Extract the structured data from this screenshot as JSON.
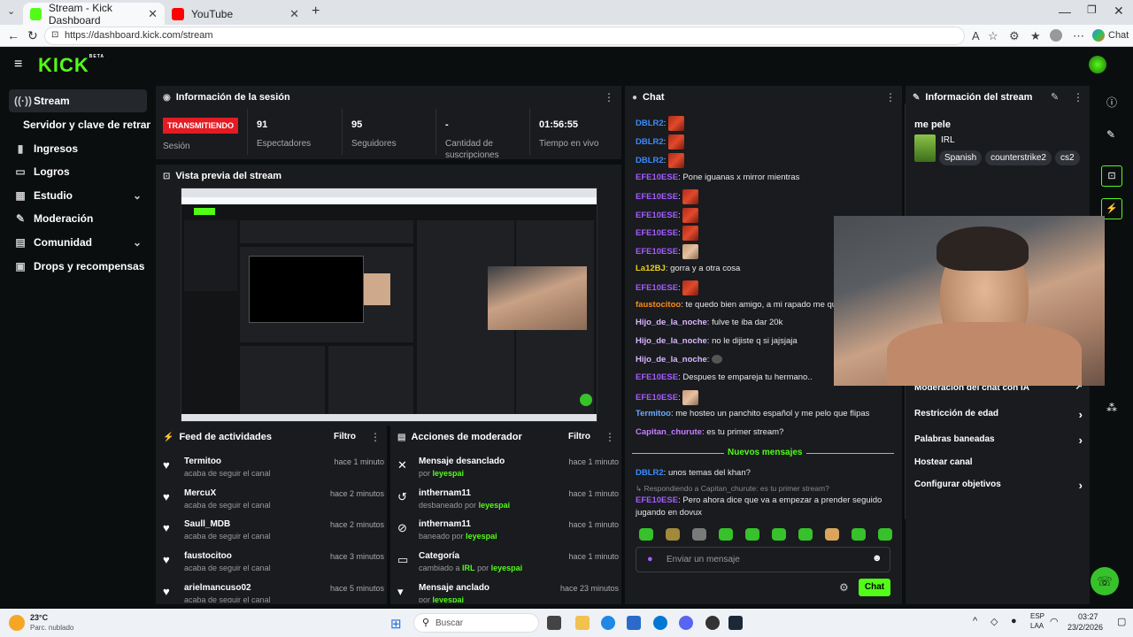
{
  "browser": {
    "tabs": [
      {
        "label": "Stream - Kick Dashboard"
      },
      {
        "label": "YouTube"
      }
    ],
    "url": "https://dashboard.kick.com/stream",
    "chat_button": "Chat"
  },
  "brand": {
    "logo": "KICK",
    "beta": "BETA",
    "accent": "#53fc18"
  },
  "sidebar": {
    "items": [
      {
        "label": "Stream",
        "icon": "stream-icon"
      },
      {
        "label": "Servidor y clave de retransm"
      },
      {
        "label": "Ingresos",
        "icon": "chart-icon"
      },
      {
        "label": "Logros",
        "icon": "trophy-icon"
      },
      {
        "label": "Estudio",
        "icon": "studio-icon"
      },
      {
        "label": "Moderación",
        "icon": "wrench-icon"
      },
      {
        "label": "Comunidad",
        "icon": "community-icon"
      },
      {
        "label": "Drops y recompensas",
        "icon": "gift-icon"
      }
    ]
  },
  "session": {
    "title": "Información de la sesión",
    "status": "TRANSMITIENDO",
    "status_label": "Sesión",
    "stats": [
      {
        "value": "91",
        "label": "Espectadores"
      },
      {
        "value": "95",
        "label": "Seguidores"
      },
      {
        "value": "-",
        "label": "Cantidad de suscripciones"
      },
      {
        "value": "01:56:55",
        "label": "Tiempo en vivo"
      }
    ]
  },
  "preview": {
    "title": "Vista previa del stream"
  },
  "feed": {
    "title": "Feed de actividades",
    "filter": "Filtro",
    "items": [
      {
        "name": "Termitoo",
        "sub": "acaba de seguir el canal",
        "time": "hace 1 minuto"
      },
      {
        "name": "MercuX",
        "sub": "acaba de seguir el canal",
        "time": "hace 2 minutos"
      },
      {
        "name": "Saull_MDB",
        "sub": "acaba de seguir el canal",
        "time": "hace 2 minutos"
      },
      {
        "name": "faustocitoo",
        "sub": "acaba de seguir el canal",
        "time": "hace 3 minutos"
      },
      {
        "name": "arielmancuso02",
        "sub": "acaba de seguir el canal",
        "time": "hace 5 minutos"
      }
    ]
  },
  "modactions": {
    "title": "Acciones de moderador",
    "filter": "Filtro",
    "items": [
      {
        "name": "Mensaje desanclado",
        "pre": "por",
        "who": "leyespai",
        "time": "hace 1 minuto"
      },
      {
        "name": "inthernam11",
        "pre": "desbaneado por",
        "who": "leyespai",
        "time": "hace 1 minuto"
      },
      {
        "name": "inthernam11",
        "pre": "baneado por",
        "who": "leyespai",
        "time": "hace 1 minuto"
      },
      {
        "name": "Categoría",
        "pre": "cambiado a",
        "mid": "IRL",
        "pre2": "por",
        "who": "leyespai",
        "time": "hace 1 minuto"
      },
      {
        "name": "Mensaje anclado",
        "pre": "por",
        "who": "leyespai",
        "time": "hace 23 minutos"
      }
    ]
  },
  "chat": {
    "title": "Chat",
    "messages": [
      {
        "user": "DBLR2",
        "color": "#3a8bff",
        "text": "",
        "emote": "red"
      },
      {
        "user": "DBLR2",
        "color": "#3a8bff",
        "text": "",
        "emote": "red"
      },
      {
        "user": "DBLR2",
        "color": "#3a8bff",
        "text": "",
        "emote": "red"
      },
      {
        "user": "EFE10ESE",
        "color": "#a55cff",
        "text": "Pone iguanas x mirror mientras",
        "emote": ""
      },
      {
        "user": "EFE10ESE",
        "color": "#a55cff",
        "text": "",
        "emote": "red"
      },
      {
        "user": "EFE10ESE",
        "color": "#a55cff",
        "text": "",
        "emote": "red"
      },
      {
        "user": "EFE10ESE",
        "color": "#a55cff",
        "text": "",
        "emote": "red"
      },
      {
        "user": "EFE10ESE",
        "color": "#a55cff",
        "text": "",
        "emote": "skin"
      },
      {
        "user": "La12BJ",
        "color": "#e6d21b",
        "text": "gorra y a otra cosa",
        "emote": ""
      },
      {
        "user": "EFE10ESE",
        "color": "#a55cff",
        "text": "",
        "emote": "red"
      },
      {
        "user": "faustocitoo",
        "color": "#ff8c1a",
        "text": "te quedo bien amigo, a mi rapado me que",
        "emote": ""
      },
      {
        "user": "Hijo_de_la_noche",
        "color": "#d9b8ff",
        "text": "fulve te iba dar 20k",
        "emote": ""
      },
      {
        "user": "Hijo_de_la_noche",
        "color": "#d9b8ff",
        "text": "no le dijiste q si jajsjaja",
        "emote": ""
      },
      {
        "user": "Hijo_de_la_noche",
        "color": "#d9b8ff",
        "text": "",
        "emote": "tiny"
      },
      {
        "user": "EFE10ESE",
        "color": "#a55cff",
        "text": "Despues te empareja tu hermano..",
        "emote": ""
      },
      {
        "user": "EFE10ESE",
        "color": "#a55cff",
        "text": "",
        "emote": "skin"
      },
      {
        "user": "Termitoo",
        "color": "#6fa8ff",
        "text": "me hosteo un panchito español y me pelo que flipas",
        "emote": ""
      },
      {
        "user": "Capitan_churute",
        "color": "#c77dff",
        "text": "es tu primer stream?",
        "emote": ""
      }
    ],
    "new_messages": "Nuevos mensajes",
    "after": [
      {
        "user": "DBLR2",
        "color": "#3a8bff",
        "text": "unos temas del khan?"
      }
    ],
    "reply_to": "Respondiendo a Capitan_churute: es tu primer stream?",
    "reply_user": "EFE10ESE",
    "reply_text_1": "Pero ahora dice que va a empezar a prender seguido",
    "reply_text_2": "jugando en dovux",
    "input_placeholder": "Enviar un mensaje",
    "send": "Chat"
  },
  "streaminfo": {
    "title": "Información del stream",
    "stream_title": "me pele",
    "category": "IRL",
    "tags": [
      "Spanish",
      "counterstrike2",
      "cs2"
    ],
    "menu": [
      {
        "label": "Moderación del chat con IA",
        "arrow": "↗"
      },
      {
        "label": "Restricción de edad",
        "arrow": "›"
      },
      {
        "label": "Palabras baneadas",
        "arrow": "›"
      },
      {
        "label": "Hostear canal",
        "arrow": ""
      },
      {
        "label": "Configurar objetivos",
        "arrow": "›"
      }
    ]
  },
  "taskbar": {
    "temp": "23°C",
    "weather": "Parc. nublado",
    "search": "Buscar",
    "lang1": "ESP",
    "lang2": "LAA",
    "time": "03:27",
    "date": "23/2/2026"
  }
}
